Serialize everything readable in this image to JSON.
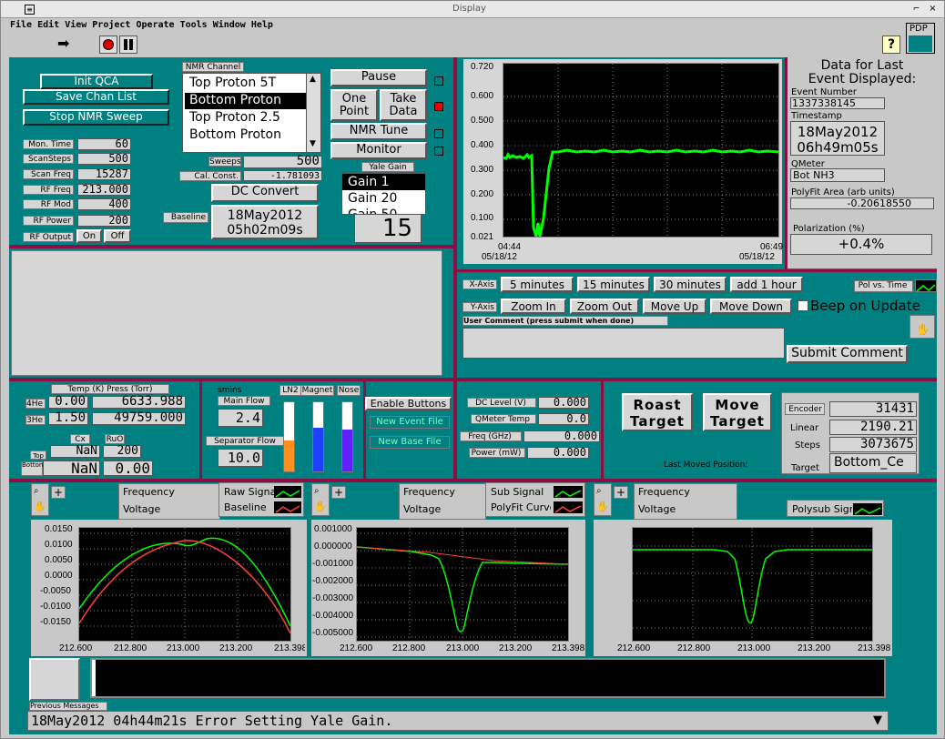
{
  "window": {
    "title": "Display"
  },
  "menu": [
    "File",
    "Edit",
    "View",
    "Project",
    "Operate",
    "Tools",
    "Window",
    "Help"
  ],
  "pdp": "PDP",
  "init_qca": "Init QCA",
  "save_chan": "Save Chan List",
  "stop_nmr": "Stop NMR Sweep",
  "nmr_channel_label": "NMR Channel",
  "nmr_channels": [
    "Top Proton 5T",
    "Bottom Proton",
    "Top Proton 2.5",
    "Bottom Proton"
  ],
  "params": [
    {
      "label": "Mon. Time",
      "value": "60"
    },
    {
      "label": "ScanSteps",
      "value": "500"
    },
    {
      "label": "Scan Freq",
      "value": "15287"
    },
    {
      "label": "RF Freq",
      "value": "213.000"
    },
    {
      "label": "RF Mod",
      "value": "400"
    },
    {
      "label": "RF Power",
      "value": "200"
    }
  ],
  "rf_output": {
    "label": "RF Output",
    "on": "On",
    "off": "Off"
  },
  "sweeps": {
    "label": "Sweeps",
    "value": "500"
  },
  "cal_const": {
    "label": "Cal. Const.",
    "value": "-1.781093"
  },
  "dc_convert": "DC Convert",
  "baseline": {
    "label": "Baseline",
    "line1": "18May2012",
    "line2": "05h02m09s"
  },
  "buttons": {
    "pause": "Pause",
    "one_point": "One Point",
    "take_data": "Take Data",
    "nmr_tune": "NMR Tune",
    "monitor": "Monitor"
  },
  "yale_gain": {
    "label": "Yale Gain",
    "options": [
      "Gain 1",
      "Gain 20",
      "Gain 50"
    ],
    "value": "15"
  },
  "event": {
    "title": "Data for Last Event Displayed:",
    "number_label": "Event Number",
    "number": "1337338145",
    "timestamp_label": "Timestamp",
    "date": "18May2012",
    "time": "06h49m05s",
    "qmeter_label": "QMeter",
    "qmeter": "Bot NH3",
    "polyfit_label": "PolyFit Area (arb units)",
    "polyfit": "-0.20618550",
    "pol_label": "Polarization (%)",
    "pol": "+0.4%"
  },
  "top_chart": {
    "y_ticks": [
      "0.720",
      "0.600",
      "0.500",
      "0.400",
      "0.300",
      "0.200",
      "0.100",
      "0.021"
    ],
    "x_left": "04:44",
    "x_left2": "05/18/12",
    "x_right": "06:49",
    "x_right2": "05/18/12"
  },
  "xaxis": {
    "label": "X-Axis",
    "buttons": [
      "5 minutes",
      "15 minutes",
      "30 minutes",
      "add 1 hour"
    ]
  },
  "yaxis": {
    "label": "Y-Axis",
    "buttons": [
      "Zoom In",
      "Zoom Out",
      "Move Up",
      "Move Down"
    ]
  },
  "beep": "Beep on Update",
  "pol_vs_time": "Pol vs. Time",
  "comment": {
    "label": "User Comment (press submit when done)",
    "submit": "Submit Comment"
  },
  "temps": {
    "header": "Temp (K) Press (Torr)",
    "he4_label": "4He",
    "he4_t": "0.00",
    "he4_p": "6633.988",
    "he3_label": "3He",
    "he3_t": "1.50",
    "he3_p": "49759.000",
    "cx": "Cx",
    "ruo": "RuO",
    "top": "Top",
    "bottom": "Bottom",
    "top_cx": "NaN",
    "top_ruo": "200",
    "bot_cx": "NaN",
    "bot_ruo": "0.00"
  },
  "flows": {
    "units": "smins",
    "main_label": "Main Flow",
    "main": "2.4",
    "sep_label": "Separator Flow",
    "sep": "10.0"
  },
  "levels": {
    "ln2": "LN2",
    "magnet": "Magnet",
    "nose": "Nose"
  },
  "enable": {
    "enable": "Enable Buttons",
    "new_event": "New Event File",
    "new_base": "New Base File"
  },
  "meters": [
    {
      "label": "DC Level (V)",
      "value": "0.000"
    },
    {
      "label": "QMeter Temp",
      "value": "0.0"
    },
    {
      "label": "Freq (GHz)",
      "value": "0.000"
    },
    {
      "label": "Power (mW)",
      "value": "0.000"
    }
  ],
  "target": {
    "roast": "Roast Target",
    "move": "Move Target",
    "encoder_label": "Encoder",
    "encoder": "31431",
    "linear_label": "Linear",
    "linear": "2190.21",
    "steps_label": "Steps",
    "steps": "3073675",
    "target_label": "Target",
    "target": "Bottom_Ce",
    "last_moved": "Last Moved Position:"
  },
  "legend": {
    "frequency": "Frequency",
    "voltage": "Voltage",
    "raw": "Raw Signal",
    "baseline": "Baseline",
    "sub": "Sub Signal",
    "polyfit": "PolyFit Curve",
    "polysub": "Polysub Signal"
  },
  "chart_data": [
    {
      "type": "line",
      "x_ticks": [
        "212.600",
        "212.800",
        "213.000",
        "213.200",
        "213.398"
      ],
      "y_ticks": [
        "0.0150",
        "0.0100",
        "0.0050",
        "0.0000",
        "-0.0050",
        "-0.0100",
        "-0.0150"
      ],
      "ylim": [
        -0.0175,
        0.0175
      ],
      "series": [
        {
          "name": "Raw Signal",
          "color": "#00ff00"
        },
        {
          "name": "Baseline",
          "color": "#ff4040"
        }
      ]
    },
    {
      "type": "line",
      "x_ticks": [
        "212.600",
        "212.800",
        "213.000",
        "213.200",
        "213.398"
      ],
      "y_ticks": [
        "0.001000",
        "0.000000",
        "-0.001000",
        "-0.002000",
        "-0.003000",
        "-0.004000",
        "-0.005000"
      ],
      "ylim": [
        -0.0053,
        0.0011
      ],
      "series": [
        {
          "name": "Sub Signal",
          "color": "#00ff00"
        },
        {
          "name": "PolyFit Curve",
          "color": "#ff4040"
        }
      ]
    },
    {
      "type": "line",
      "x_ticks": [
        "212.600",
        "212.800",
        "213.000",
        "213.200",
        "213.398"
      ],
      "series": [
        {
          "name": "Polysub Signal",
          "color": "#00ff00"
        }
      ]
    }
  ],
  "prev_messages": "Previous Messages",
  "status": "18May2012 04h44m21s Error Setting Yale Gain.",
  "colors": {
    "teal": "#008080",
    "maroon": "#8c0f43",
    "green": "#00ff00",
    "red": "#ff4040"
  }
}
